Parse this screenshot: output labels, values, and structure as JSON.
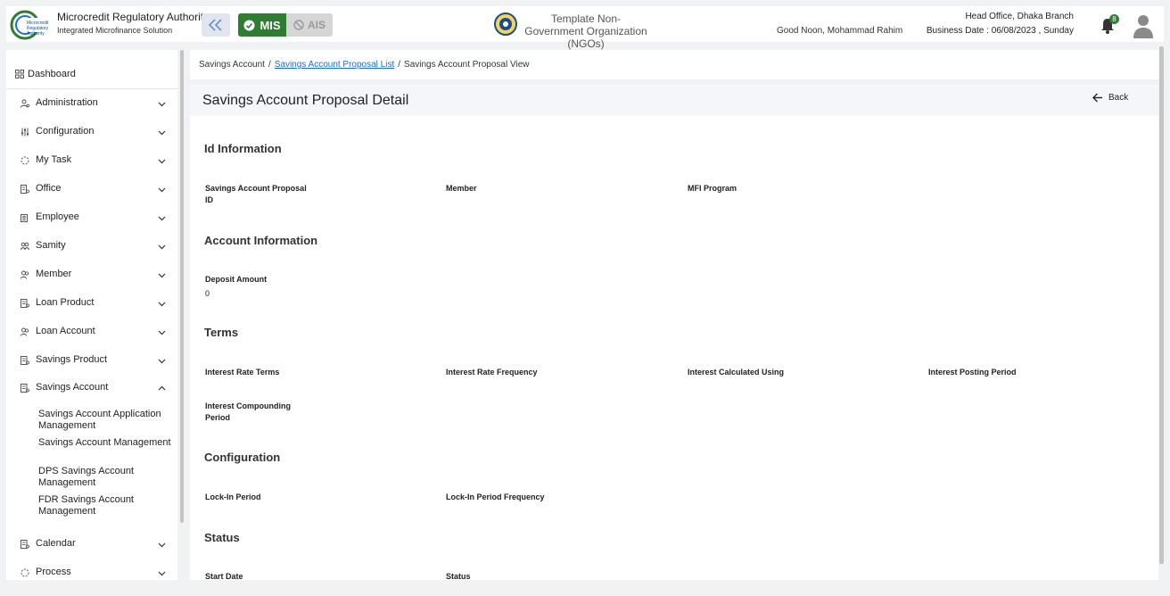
{
  "header": {
    "brand_title": "Microcredit Regulatory Authority",
    "brand_subtitle": "Integrated Microfinance Solution",
    "mis_label": "MIS",
    "ais_label": "AIS",
    "org_name": "Template Non-Government Organization (NGOs)",
    "greeting": "Good Noon, Mohammad Rahim",
    "branch": "Head Office, Dhaka Branch",
    "business_date": "Business Date : 06/08/2023 , Sunday",
    "notification_count": "8",
    "accent_color": "#2e7d32"
  },
  "sidebar": {
    "dashboard": "Dashboard",
    "items": [
      {
        "label": "Administration",
        "icon": "user-gear-icon"
      },
      {
        "label": "Configuration",
        "icon": "sliders-icon"
      },
      {
        "label": "My Task",
        "icon": "spinner-icon"
      },
      {
        "label": "Office",
        "icon": "building-icon"
      },
      {
        "label": "Employee",
        "icon": "badge-icon"
      },
      {
        "label": "Samity",
        "icon": "group-icon"
      },
      {
        "label": "Member",
        "icon": "users-icon"
      },
      {
        "label": "Loan Product",
        "icon": "document-icon"
      },
      {
        "label": "Loan Account",
        "icon": "users-icon"
      },
      {
        "label": "Savings Product",
        "icon": "document-icon"
      },
      {
        "label": "Savings Account",
        "icon": "document-icon"
      },
      {
        "label": "Calendar",
        "icon": "document-icon"
      },
      {
        "label": "Process",
        "icon": "spinner-icon"
      }
    ],
    "sub_items": [
      "Savings Account Application Management",
      "Savings Account Management",
      "DPS Savings Account Management",
      "FDR Savings Account Management"
    ]
  },
  "breadcrumb": {
    "root": "Savings Account",
    "sep": "/",
    "list": "Savings Account Proposal List",
    "current": "Savings Account Proposal View"
  },
  "page": {
    "title": "Savings Account Proposal Detail",
    "back": "Back",
    "sections": {
      "id_info": "Id Information",
      "account_info": "Account Information",
      "terms": "Terms",
      "configuration": "Configuration",
      "status": "Status"
    },
    "fields": {
      "proposal_id": "Savings Account Proposal ID",
      "member": "Member",
      "mfi_program": "MFI Program",
      "deposit_amount": "Deposit Amount",
      "deposit_amount_value": "0",
      "interest_rate_terms": "Interest Rate Terms",
      "interest_rate_frequency": "Interest Rate Frequency",
      "interest_calculated_using": "Interest Calculated Using",
      "interest_posting_period": "Interest Posting Period",
      "interest_compounding_period": "Interest Compounding Period",
      "lock_in_period": "Lock-In Period",
      "lock_in_period_frequency": "Lock-In Period Frequency",
      "start_date": "Start Date",
      "status": "Status"
    }
  }
}
